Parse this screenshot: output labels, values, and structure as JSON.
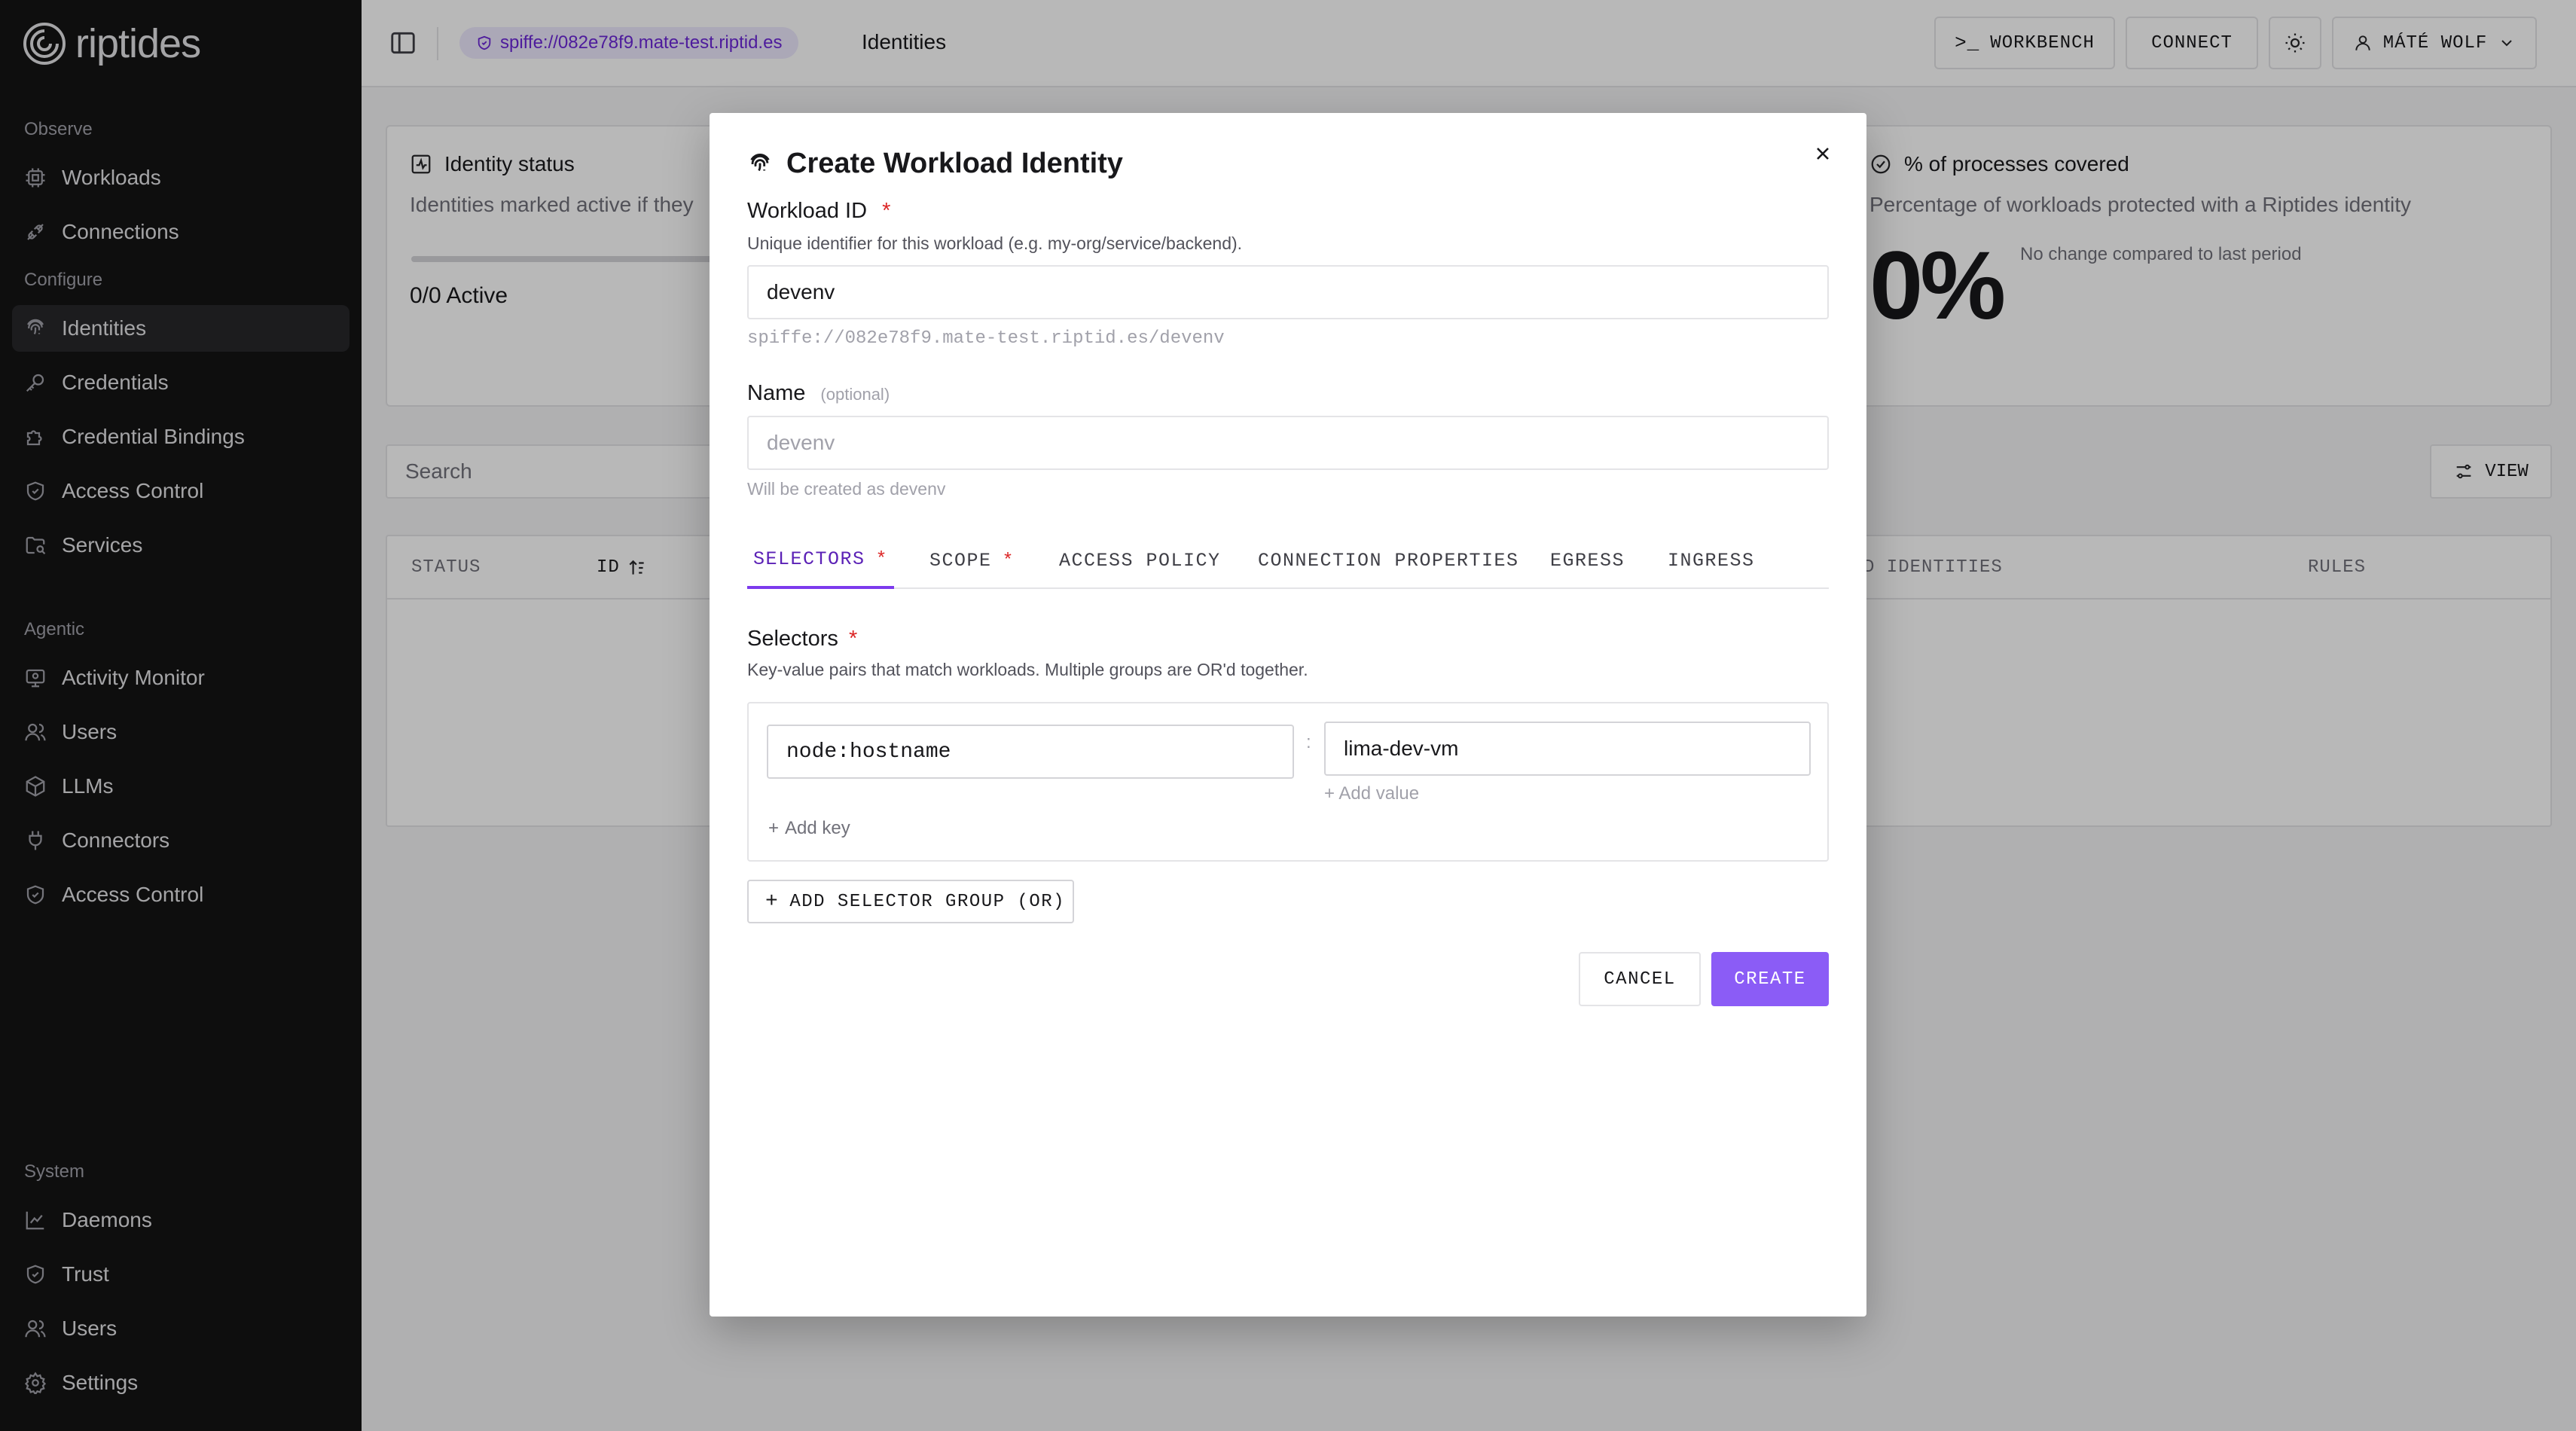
{
  "app": {
    "name": "riptides"
  },
  "sidebar": {
    "sections": {
      "observe": "Observe",
      "configure": "Configure",
      "agentic": "Agentic",
      "system": "System"
    },
    "items": [
      {
        "label": "Workloads",
        "icon": "cpu-icon"
      },
      {
        "label": "Connections",
        "icon": "connection-icon"
      },
      {
        "label": "Identities",
        "icon": "fingerprint-icon",
        "active": true
      },
      {
        "label": "Credentials",
        "icon": "key-icon"
      },
      {
        "label": "Credential Bindings",
        "icon": "puzzle-icon"
      },
      {
        "label": "Access Control",
        "icon": "shield-icon"
      },
      {
        "label": "Services",
        "icon": "folder-search-icon"
      },
      {
        "label": "Activity Monitor",
        "icon": "monitor-icon"
      },
      {
        "label": "Users",
        "icon": "users-icon"
      },
      {
        "label": "LLMs",
        "icon": "box-icon"
      },
      {
        "label": "Connectors",
        "icon": "plug-icon"
      },
      {
        "label": "Access Control",
        "icon": "shield-icon"
      },
      {
        "label": "Daemons",
        "icon": "chart-line-icon"
      },
      {
        "label": "Trust",
        "icon": "shield-icon"
      },
      {
        "label": "Users",
        "icon": "users-icon"
      },
      {
        "label": "Settings",
        "icon": "gear-icon"
      }
    ]
  },
  "topbar": {
    "spiffe": "spiffe://082e78f9.mate-test.riptid.es",
    "breadcrumb": "Identities",
    "workbench": "WORKBENCH",
    "connect": "CONNECT",
    "user": "MÁTÉ WOLF"
  },
  "main": {
    "identity_status": {
      "title": "Identity status",
      "desc": "Identities marked active if they",
      "value": "0/0 Active"
    },
    "coverage": {
      "title": "% of processes covered",
      "desc": "Percentage of workloads protected with a Riptides identity",
      "value": "0%",
      "change": "No change compared to last period"
    },
    "search_placeholder": "Search",
    "view_label": "VIEW",
    "table_headers": {
      "status": "STATUS",
      "id": "ID",
      "identities": "D IDENTITIES",
      "rules": "RULES"
    }
  },
  "modal": {
    "title": "Create Workload Identity",
    "workload_id": {
      "label": "Workload ID",
      "required": "*",
      "help": "Unique identifier for this workload (e.g. my-org/service/backend).",
      "value": "devenv",
      "spiffe_preview": "spiffe://082e78f9.mate-test.riptid.es/devenv"
    },
    "name": {
      "label": "Name",
      "optional": "(optional)",
      "placeholder": "devenv",
      "help": "Will be created as devenv"
    },
    "tabs": [
      {
        "label": "SELECTORS",
        "required": "*",
        "active": true
      },
      {
        "label": "SCOPE",
        "required": "*"
      },
      {
        "label": "ACCESS POLICY"
      },
      {
        "label": "CONNECTION PROPERTIES"
      },
      {
        "label": "EGRESS"
      },
      {
        "label": "INGRESS"
      }
    ],
    "selectors": {
      "label": "Selectors",
      "required": "*",
      "help": "Key-value pairs that match workloads. Multiple groups are OR'd together.",
      "key": "node:hostname",
      "separator": ":",
      "value": "lima-dev-vm",
      "add_value": "+ Add value",
      "add_key": "Add key",
      "add_group": "ADD SELECTOR GROUP (OR)"
    },
    "cancel": "CANCEL",
    "create": "CREATE"
  },
  "colors": {
    "accent": "#8b5cf6",
    "sidebar_bg": "#141414",
    "required": "#dc2626"
  }
}
